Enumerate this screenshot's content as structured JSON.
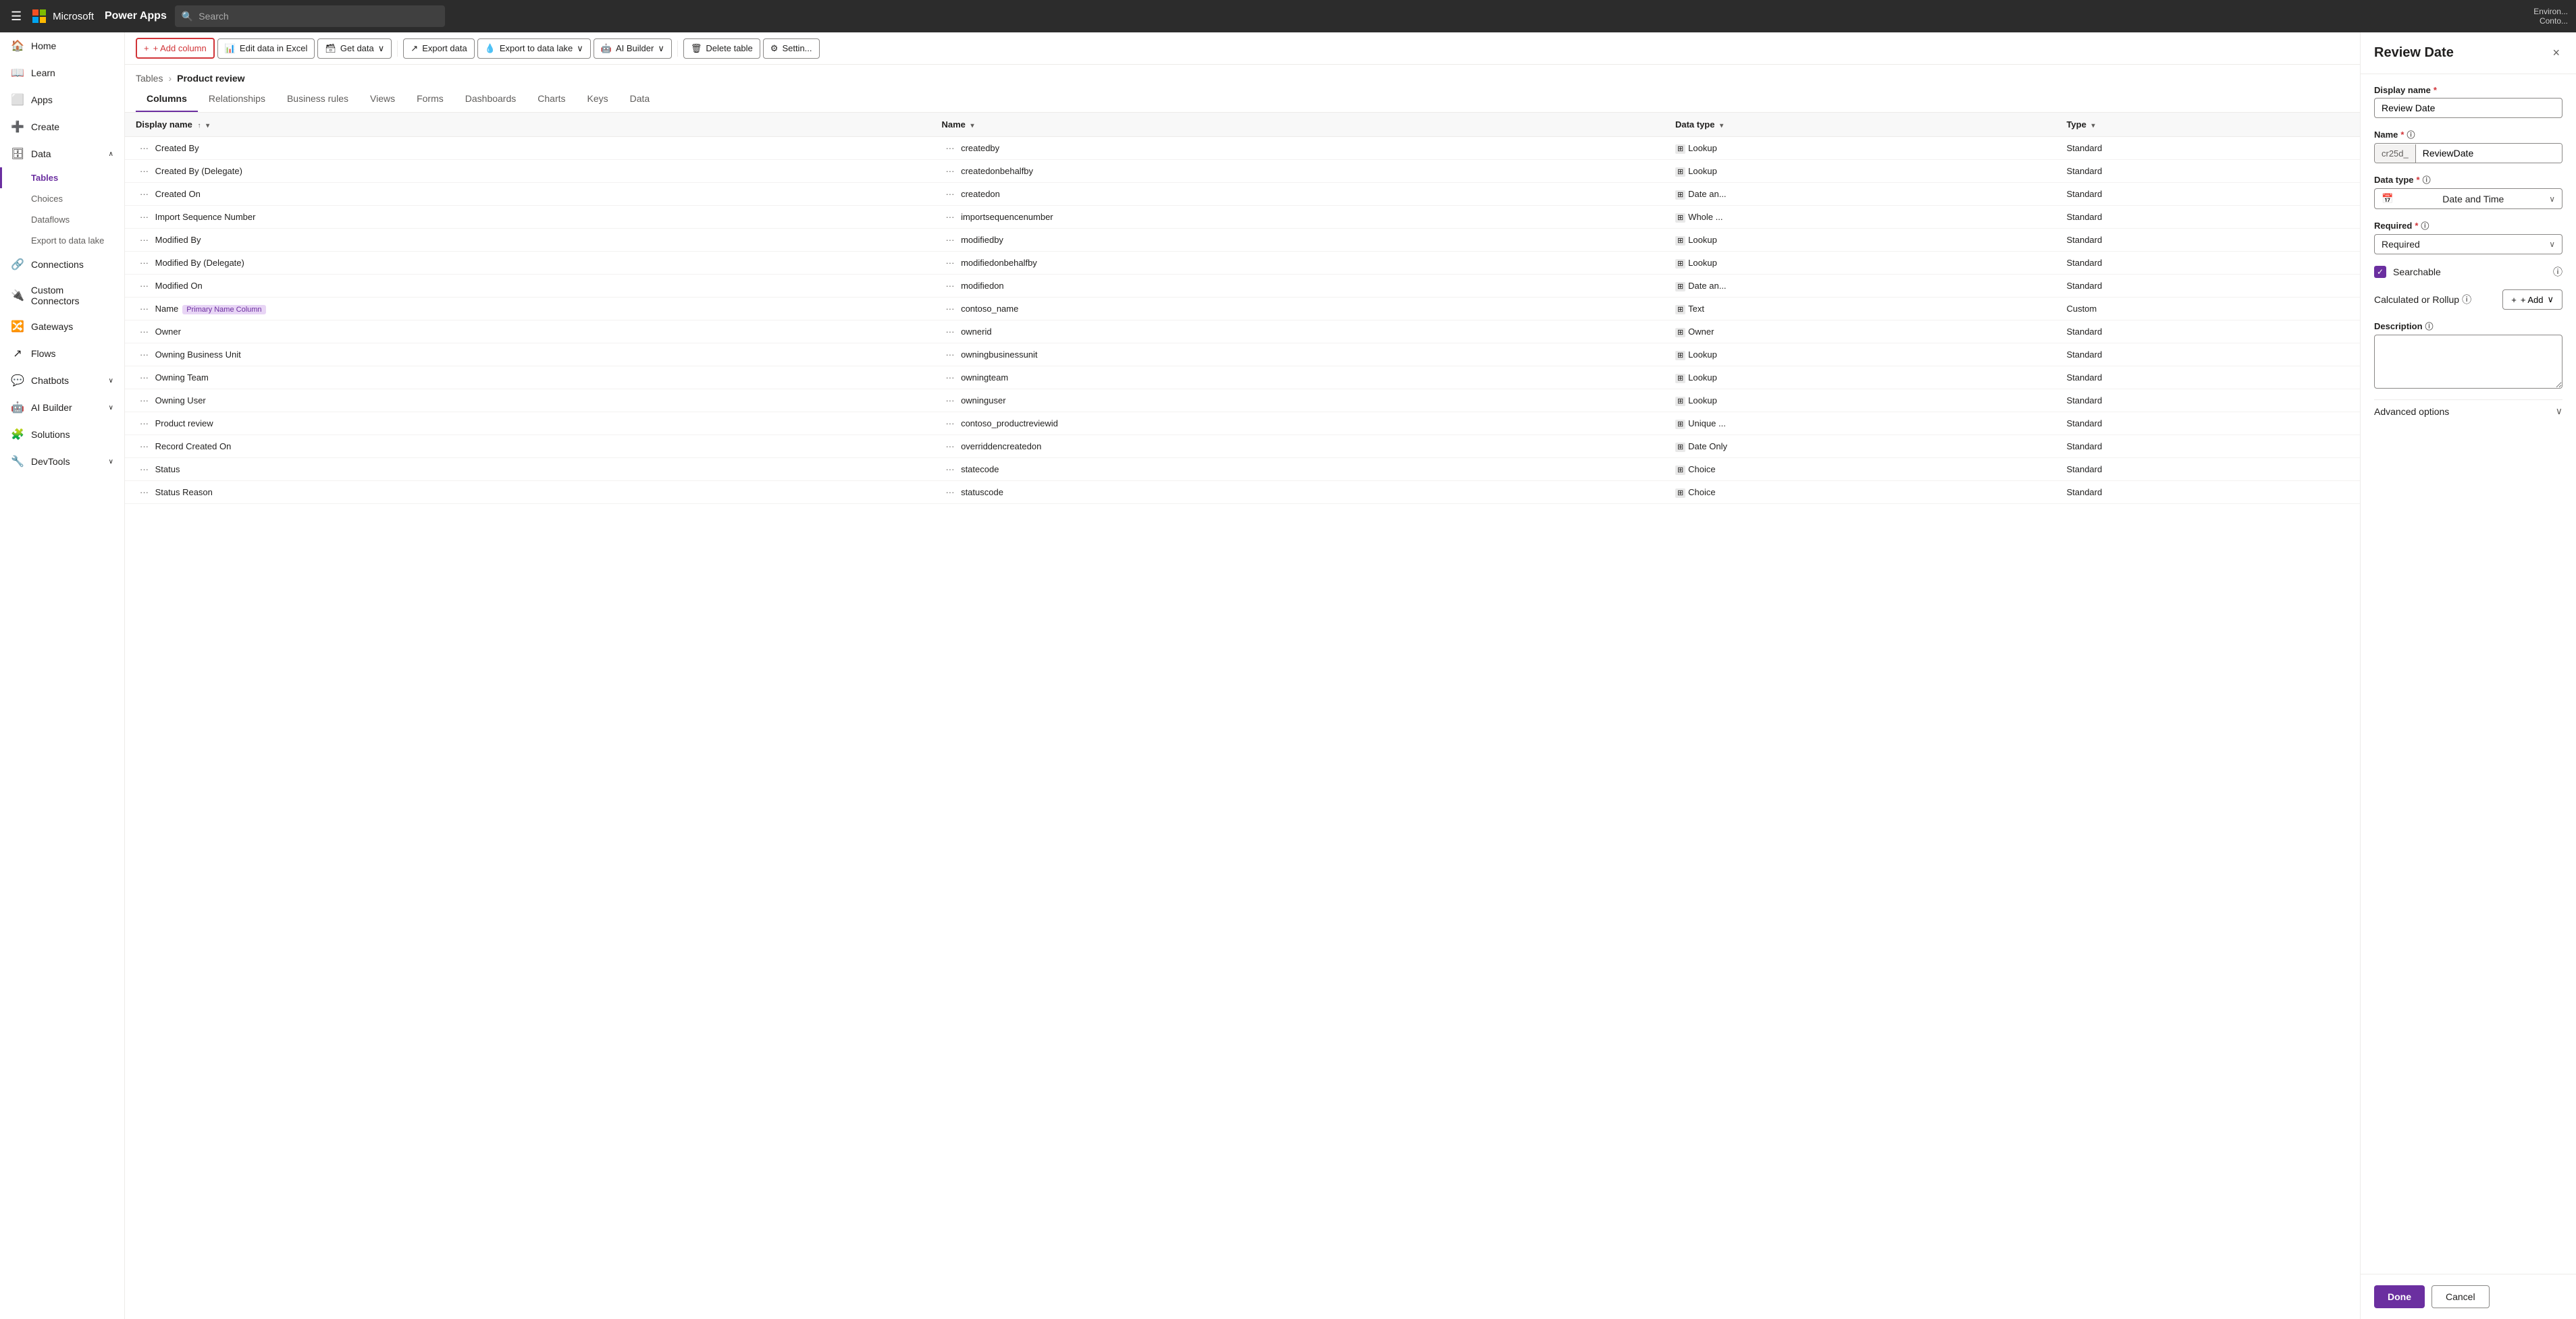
{
  "topNav": {
    "appName": "Power Apps",
    "searchPlaceholder": "Search",
    "environment": "Environ...",
    "user": "Conto..."
  },
  "sidebar": {
    "items": [
      {
        "id": "home",
        "label": "Home",
        "icon": "🏠"
      },
      {
        "id": "learn",
        "label": "Learn",
        "icon": "📖"
      },
      {
        "id": "apps",
        "label": "Apps",
        "icon": "⬜"
      },
      {
        "id": "create",
        "label": "Create",
        "icon": "➕"
      },
      {
        "id": "data",
        "label": "Data",
        "icon": "🗄",
        "expanded": true
      },
      {
        "id": "connections",
        "label": "Connections",
        "icon": ""
      },
      {
        "id": "custom-connectors",
        "label": "Custom Connectors",
        "icon": ""
      },
      {
        "id": "gateways",
        "label": "Gateways",
        "icon": ""
      },
      {
        "id": "flows",
        "label": "Flows",
        "icon": "↗"
      },
      {
        "id": "chatbots",
        "label": "Chatbots",
        "icon": "💬",
        "hasChevron": true
      },
      {
        "id": "ai-builder",
        "label": "AI Builder",
        "icon": "🤖",
        "hasChevron": true
      },
      {
        "id": "solutions",
        "label": "Solutions",
        "icon": "🧩"
      },
      {
        "id": "devtools",
        "label": "DevTools",
        "icon": "🔧",
        "hasChevron": true
      }
    ],
    "subItems": [
      {
        "id": "tables",
        "label": "Tables",
        "active": true
      },
      {
        "id": "choices",
        "label": "Choices"
      },
      {
        "id": "dataflows",
        "label": "Dataflows"
      },
      {
        "id": "export-to-data-lake",
        "label": "Export to data lake"
      }
    ]
  },
  "breadcrumb": {
    "parent": "Tables",
    "current": "Product review"
  },
  "tabs": [
    {
      "id": "columns",
      "label": "Columns",
      "active": true
    },
    {
      "id": "relationships",
      "label": "Relationships"
    },
    {
      "id": "business-rules",
      "label": "Business rules"
    },
    {
      "id": "views",
      "label": "Views"
    },
    {
      "id": "forms",
      "label": "Forms"
    },
    {
      "id": "dashboards",
      "label": "Dashboards"
    },
    {
      "id": "charts",
      "label": "Charts"
    },
    {
      "id": "keys",
      "label": "Keys"
    },
    {
      "id": "data",
      "label": "Data"
    }
  ],
  "toolbar": {
    "addColumn": "+ Add column",
    "editDataInExcel": "Edit data in Excel",
    "getData": "Get data",
    "exportData": "Export data",
    "exportToDataLake": "Export to data lake",
    "aiBuilder": "AI Builder",
    "deleteTable": "Delete table",
    "settings": "Settin..."
  },
  "tableColumns": {
    "headers": [
      {
        "id": "display-name",
        "label": "Display name",
        "sortable": true
      },
      {
        "id": "name",
        "label": "Name",
        "sortable": true
      },
      {
        "id": "data-type",
        "label": "Data type",
        "sortable": true
      },
      {
        "id": "type",
        "label": "Type",
        "sortable": true
      }
    ],
    "rows": [
      {
        "displayName": "Created By",
        "name": "createdby",
        "dataType": "Lookup",
        "type": "Standard",
        "dataTypeIcon": "🔲"
      },
      {
        "displayName": "Created By (Delegate)",
        "name": "createdonbehalfby",
        "dataType": "Lookup",
        "type": "Standard",
        "dataTypeIcon": "🔲"
      },
      {
        "displayName": "Created On",
        "name": "createdon",
        "dataType": "Date an...",
        "type": "Standard",
        "dataTypeIcon": "🔲"
      },
      {
        "displayName": "Import Sequence Number",
        "name": "importsequencenumber",
        "dataType": "Whole ...",
        "type": "Standard",
        "dataTypeIcon": "🔲"
      },
      {
        "displayName": "Modified By",
        "name": "modifiedby",
        "dataType": "Lookup",
        "type": "Standard",
        "dataTypeIcon": "🔲"
      },
      {
        "displayName": "Modified By (Delegate)",
        "name": "modifiedonbehalfby",
        "dataType": "Lookup",
        "type": "Standard",
        "dataTypeIcon": "🔲"
      },
      {
        "displayName": "Modified On",
        "name": "modifiedon",
        "dataType": "Date an...",
        "type": "Standard",
        "dataTypeIcon": "🔲"
      },
      {
        "displayName": "Name",
        "name": "contoso_name",
        "dataType": "Text",
        "type": "Custom",
        "primaryName": true,
        "dataTypeIcon": "🔲"
      },
      {
        "displayName": "Owner",
        "name": "ownerid",
        "dataType": "Owner",
        "type": "Standard",
        "dataTypeIcon": "👤"
      },
      {
        "displayName": "Owning Business Unit",
        "name": "owningbusinessunit",
        "dataType": "Lookup",
        "type": "Standard",
        "dataTypeIcon": "🔲"
      },
      {
        "displayName": "Owning Team",
        "name": "owningteam",
        "dataType": "Lookup",
        "type": "Standard",
        "dataTypeIcon": "🔲"
      },
      {
        "displayName": "Owning User",
        "name": "owninguser",
        "dataType": "Lookup",
        "type": "Standard",
        "dataTypeIcon": "🔲"
      },
      {
        "displayName": "Product review",
        "name": "contoso_productreviewid",
        "dataType": "Unique ...",
        "type": "Standard",
        "dataTypeIcon": "🔲"
      },
      {
        "displayName": "Record Created On",
        "name": "overriddencreatedon",
        "dataType": "Date Only",
        "type": "Standard",
        "dataTypeIcon": "🔲"
      },
      {
        "displayName": "Status",
        "name": "statecode",
        "dataType": "Choice",
        "type": "Standard",
        "dataTypeIcon": "🔲"
      },
      {
        "displayName": "Status Reason",
        "name": "statuscode",
        "dataType": "Choice",
        "type": "Standard",
        "dataTypeIcon": "🔲"
      }
    ]
  },
  "panel": {
    "title": "Review Date",
    "closeLabel": "×",
    "fields": {
      "displayName": {
        "label": "Display name",
        "required": true,
        "value": "Review Date"
      },
      "name": {
        "label": "Name",
        "required": true,
        "prefix": "cr25d_",
        "value": "ReviewDate"
      },
      "dataType": {
        "label": "Data type",
        "required": true,
        "icon": "📅",
        "value": "Date and Time"
      },
      "required": {
        "label": "Required",
        "required": true,
        "value": "Required"
      },
      "searchable": {
        "label": "Searchable",
        "checked": true
      },
      "calculatedOrRollup": {
        "label": "Calculated or Rollup",
        "addLabel": "+ Add"
      },
      "description": {
        "label": "Description",
        "value": ""
      }
    },
    "advancedOptions": "Advanced options",
    "doneLabel": "Done",
    "cancelLabel": "Cancel"
  }
}
